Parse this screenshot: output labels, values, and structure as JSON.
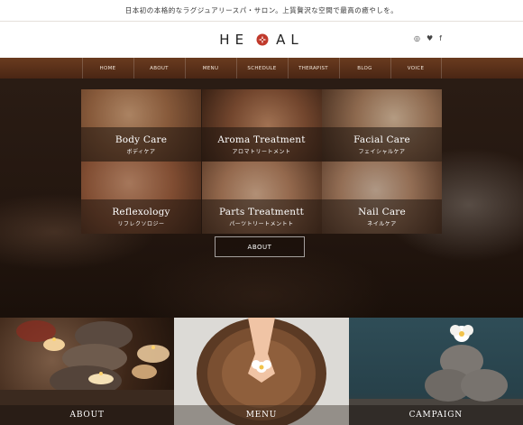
{
  "tagline": "日本初の本格的なラグジュアリースパ・サロン。上質贅沢な空間で最高の癒やしを。",
  "logo": {
    "left": "HE",
    "right": "AL",
    "mark": "lotus-mark-icon"
  },
  "social": [
    "instagram-icon",
    "twitter-icon",
    "facebook-icon"
  ],
  "social_glyphs": {
    "instagram": "◎",
    "twitter": "♥",
    "facebook": "f"
  },
  "nav": [
    "HOME",
    "ABOUT",
    "MENU",
    "SCHEDULE",
    "THERAPIST",
    "BLOG",
    "VOICE"
  ],
  "services": [
    {
      "en": "Body Care",
      "jp": "ボディケア"
    },
    {
      "en": "Aroma Treatment",
      "jp": "アロマトリートメント"
    },
    {
      "en": "Facial Care",
      "jp": "フェイシャルケア"
    },
    {
      "en": "Reflexology",
      "jp": "リフレクソロジー"
    },
    {
      "en": "Parts Treatmentt",
      "jp": "パーツトリートメントト"
    },
    {
      "en": "Nail Care",
      "jp": "ネイルケア"
    }
  ],
  "about_button": "ABOUT",
  "panels": [
    "ABOUT",
    "MENU",
    "CAMPAIGN"
  ],
  "colors": {
    "accent": "#c0392b",
    "nav_bg": "#5a3019"
  }
}
